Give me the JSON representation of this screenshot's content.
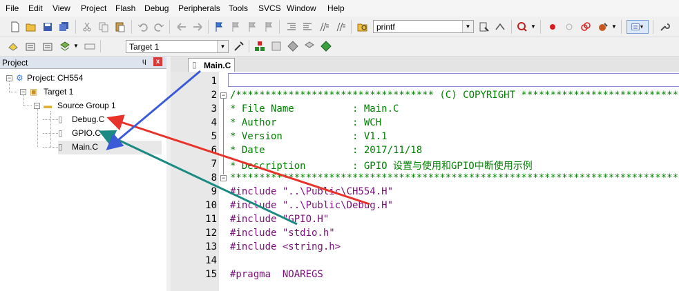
{
  "menu": [
    "File",
    "Edit",
    "View",
    "Project",
    "Flash",
    "Debug",
    "Peripherals",
    "Tools",
    "SVCS",
    "Window",
    "Help"
  ],
  "toolbar": {
    "find_combo_value": "printf",
    "target_combo_value": "Target 1"
  },
  "project_panel": {
    "title": "Project",
    "pin_glyph": "ɥ",
    "close_glyph": "x",
    "root": "Project: CH554",
    "target": "Target 1",
    "group": "Source Group 1",
    "files": [
      "Debug.C",
      "GPIO.C",
      "Main.C"
    ]
  },
  "editor": {
    "active_tab": "Main.C",
    "line_numbers": [
      "1",
      "2",
      "3",
      "4",
      "5",
      "6",
      "7",
      "8",
      "9",
      "10",
      "11",
      "12",
      "13",
      "14",
      "15"
    ],
    "lines": [
      "",
      "/********************************** (C) COPYRIGHT *******************************",
      "* File Name          : Main.C",
      "* Author             : WCH",
      "* Version            : V1.1",
      "* Date               : 2017/11/18",
      "* Description        : GPIO 设置与使用和GPIO中断使用示例",
      "*******************************************************************************/",
      "#include \"..\\Public\\CH554.H\"",
      "#include \"..\\Public\\Debug.H\"",
      "#include \"GPIO.H\"",
      "#include \"stdio.h\"",
      "#include <string.h>",
      "",
      "#pragma  NOAREGS"
    ]
  },
  "colors": {
    "arrow_red": "#e8332a",
    "arrow_teal": "#1a8a82",
    "arrow_blue": "#3a5ad8",
    "comment": "#008000",
    "preprocessor": "#7a0f7a"
  }
}
